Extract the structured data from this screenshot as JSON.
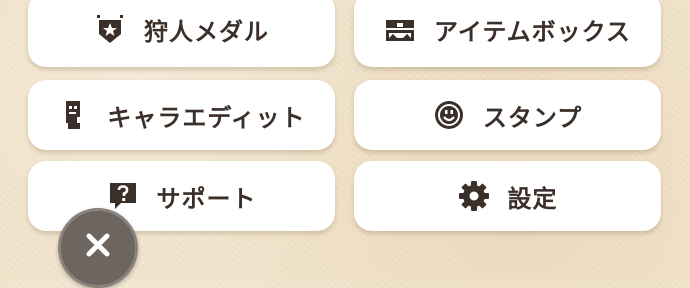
{
  "menu": {
    "hunter_medal": {
      "label": "狩人メダル",
      "icon": "shield-star-icon"
    },
    "item_box": {
      "label": "アイテムボックス",
      "icon": "treasure-chest-icon"
    },
    "chara_edit": {
      "label": "キャラエディット",
      "icon": "head-profile-icon"
    },
    "stamp": {
      "label": "スタンプ",
      "icon": "smiley-face-icon"
    },
    "support": {
      "label": "サポート",
      "icon": "question-bubble-icon"
    },
    "settings": {
      "label": "設定",
      "icon": "gear-icon"
    }
  },
  "close_button": {
    "icon": "close-icon"
  },
  "colors": {
    "background": "#f1e4cc",
    "button_bg": "#ffffff",
    "text": "#3b2f2a",
    "close_bg": "#6d655f"
  }
}
